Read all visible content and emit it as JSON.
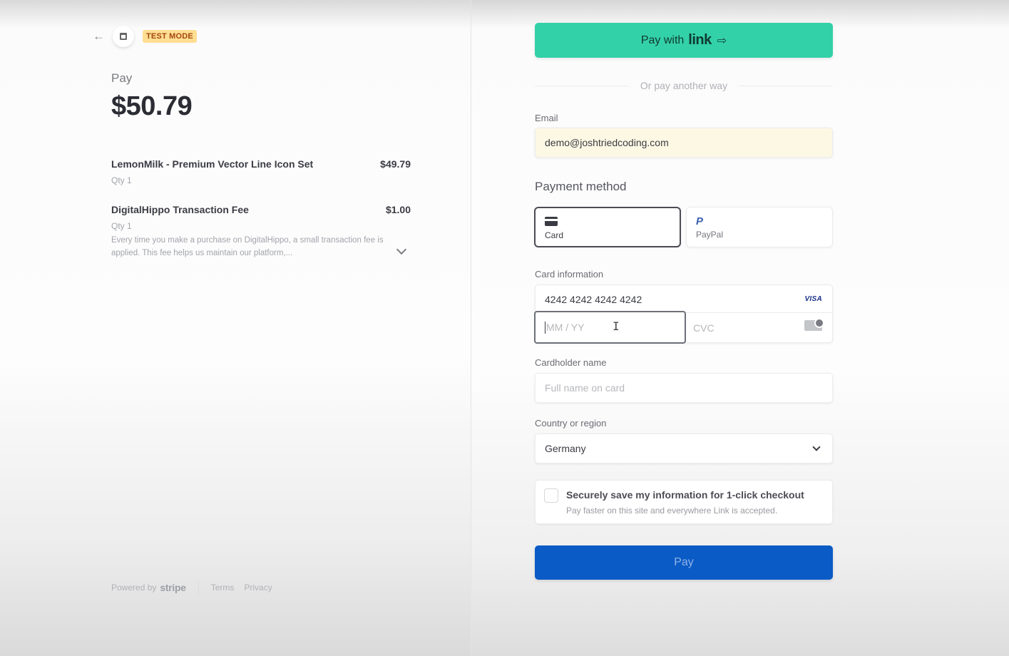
{
  "summary": {
    "test_mode_badge": "TEST MODE",
    "pay_label": "Pay",
    "total": "$50.79",
    "line_items": [
      {
        "name": "LemonMilk - Premium Vector Line Icon Set",
        "price": "$49.79",
        "qty": "Qty 1",
        "description": ""
      },
      {
        "name": "DigitalHippo Transaction Fee",
        "price": "$1.00",
        "qty": "Qty 1",
        "description": "Every time you make a purchase on DigitalHippo, a small transaction fee is applied. This fee helps us maintain our platform,..."
      }
    ],
    "footer": {
      "powered_by": "Powered by",
      "brand": "stripe",
      "terms": "Terms",
      "privacy": "Privacy"
    }
  },
  "checkout": {
    "link_button": {
      "prefix": "Pay with",
      "brand": "link",
      "arrow": "⇨"
    },
    "divider_text": "Or pay another way",
    "email": {
      "label": "Email",
      "value": "demo@joshtriedcoding.com"
    },
    "payment_method": {
      "title": "Payment method",
      "tabs": [
        {
          "label": "Card",
          "icon": "credit-card-icon",
          "selected": true
        },
        {
          "label": "PayPal",
          "icon": "paypal-icon",
          "selected": false
        }
      ]
    },
    "card_info": {
      "label": "Card information",
      "number": "4242 4242 4242 4242",
      "brand": "VISA",
      "expiry_placeholder": "MM / YY",
      "cvc_placeholder": "CVC"
    },
    "cardholder": {
      "label": "Cardholder name",
      "placeholder": "Full name on card"
    },
    "country": {
      "label": "Country or region",
      "value": "Germany"
    },
    "save_info": {
      "title": "Securely save my information for 1-click checkout",
      "subtitle": "Pay faster on this site and everywhere Link is accepted."
    },
    "pay_button": "Pay"
  },
  "colors": {
    "link_green": "#33d1a8",
    "pay_blue": "#0b5bc6",
    "test_badge": "#ffde92"
  }
}
